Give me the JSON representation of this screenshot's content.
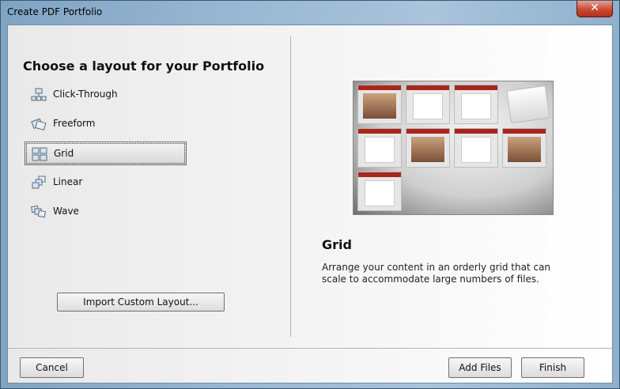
{
  "window": {
    "title": "Create PDF Portfolio",
    "close_glyph": "✕"
  },
  "left": {
    "heading": "Choose a layout for your Portfolio",
    "layouts": [
      {
        "label": "Click-Through",
        "icon": "click-through-icon"
      },
      {
        "label": "Freeform",
        "icon": "freeform-icon"
      },
      {
        "label": "Grid",
        "icon": "grid-icon",
        "selected": true
      },
      {
        "label": "Linear",
        "icon": "linear-icon"
      },
      {
        "label": "Wave",
        "icon": "wave-icon"
      }
    ],
    "import_label": "Import Custom Layout..."
  },
  "right": {
    "title": "Grid",
    "description": "Arrange your content in an orderly grid that can scale to accommodate large numbers of files."
  },
  "footer": {
    "cancel_label": "Cancel",
    "add_files_label": "Add Files",
    "finish_label": "Finish"
  },
  "colors": {
    "accent": "#a8261c",
    "close": "#c94a33"
  }
}
